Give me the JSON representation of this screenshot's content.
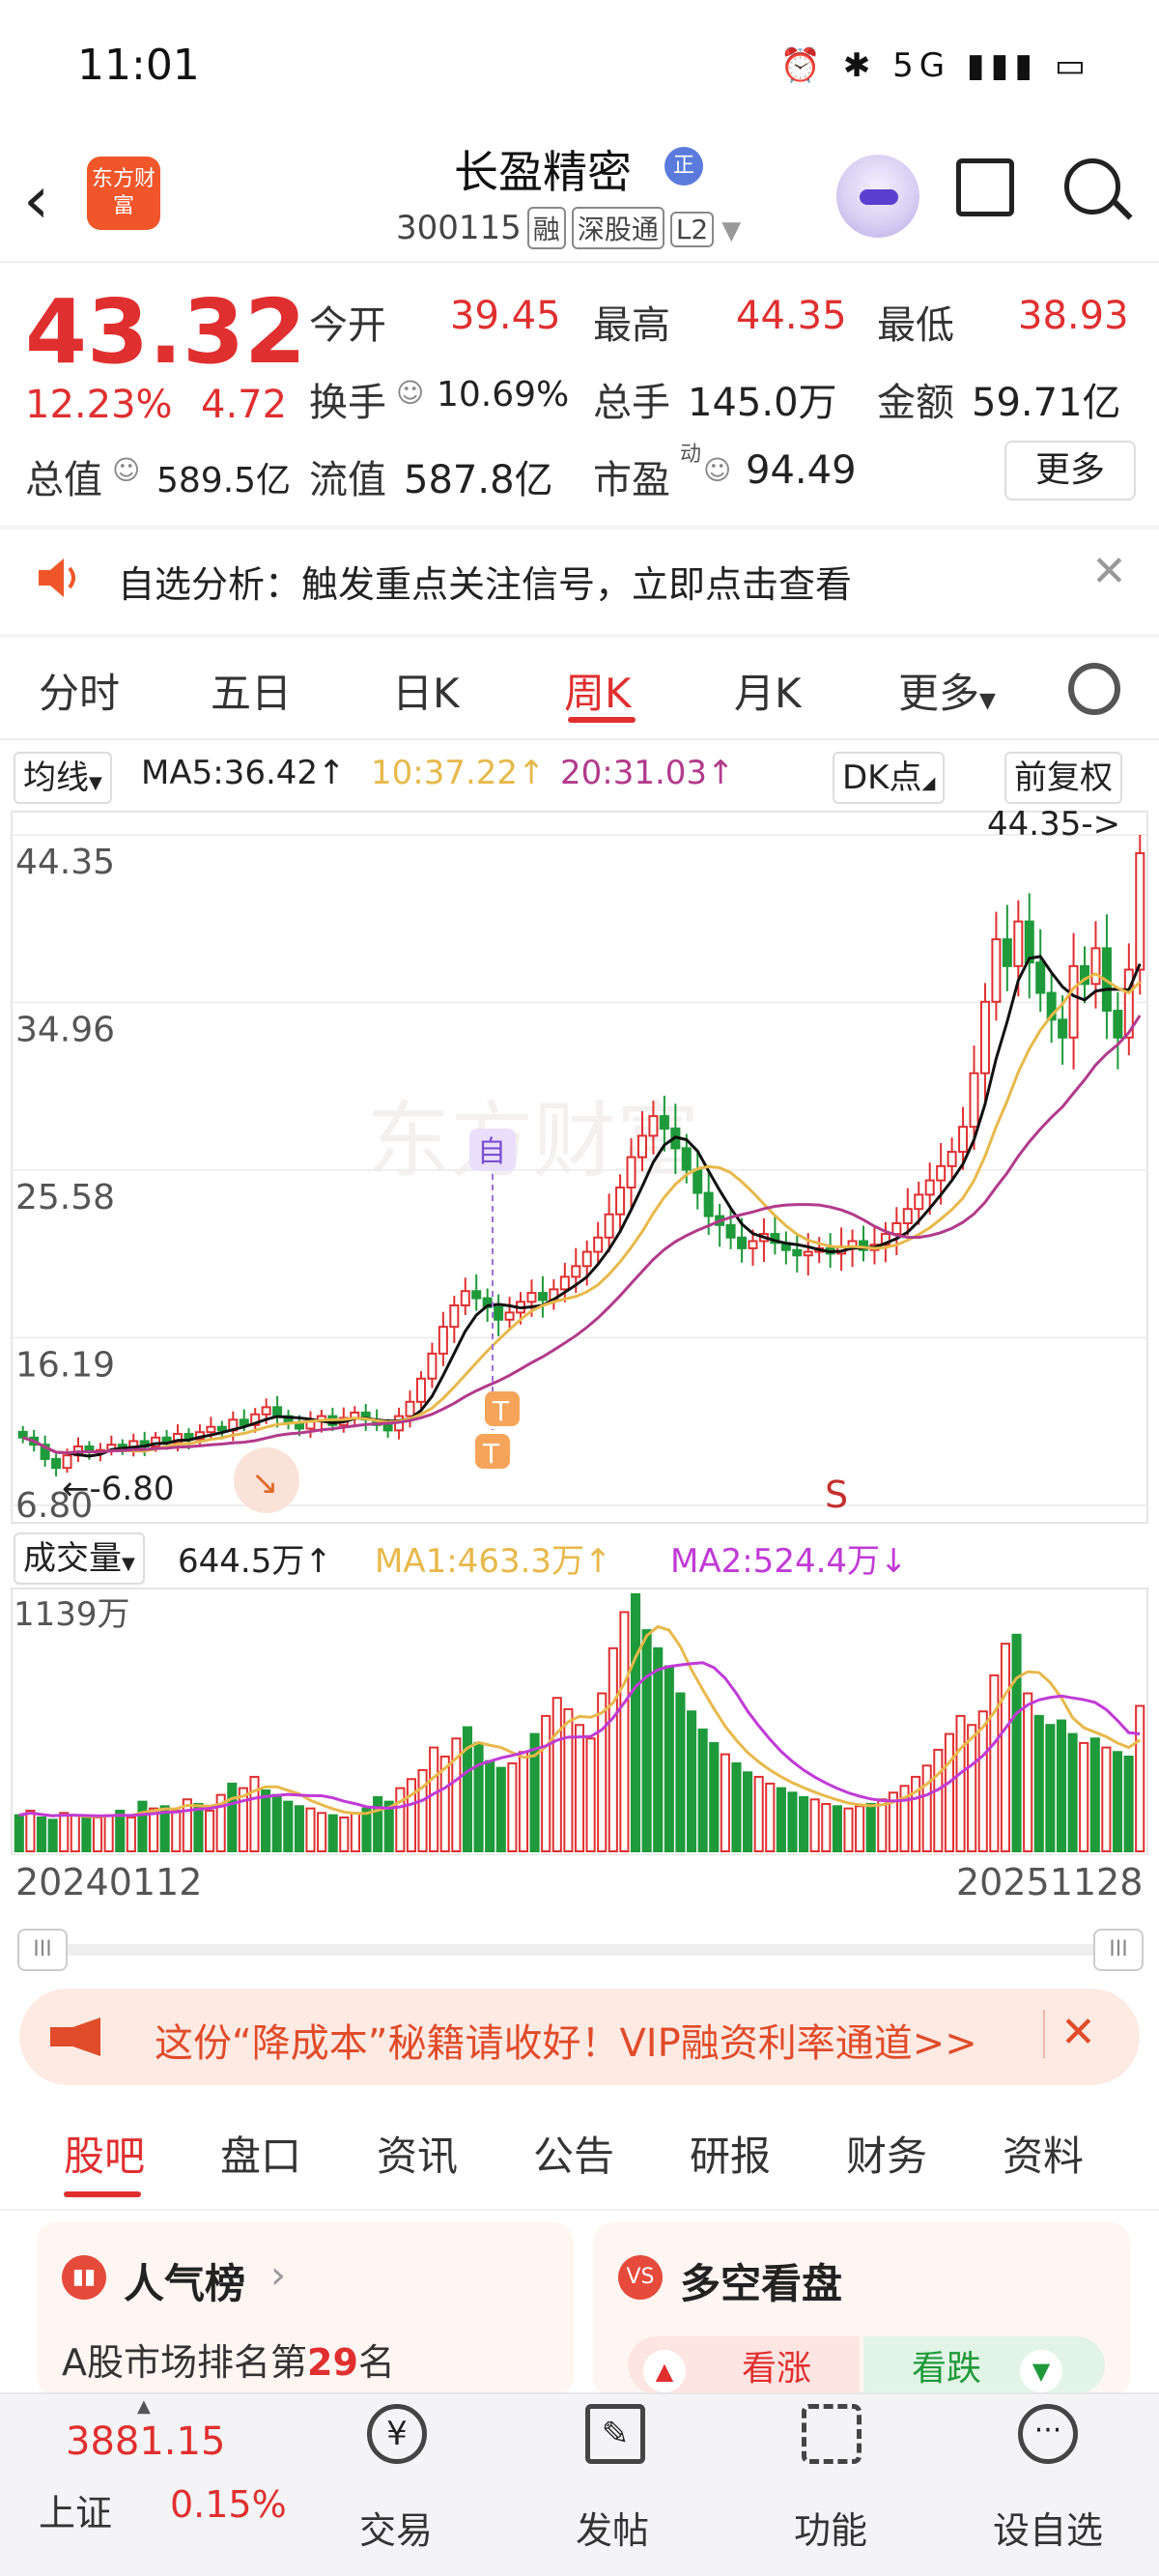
{
  "status_bar": {
    "time": "11:01",
    "icons": "⏰ ✱ 5G ▮▮▮ ▭"
  },
  "header": {
    "logo_text": "东方财富",
    "title": "长盈精密",
    "title_badge": "正",
    "code": "300115",
    "tags": [
      "融",
      "深股通",
      "L2"
    ]
  },
  "quote": {
    "price": "43.32",
    "change_pct": "12.23%",
    "change": "4.72",
    "open_label": "今开",
    "open": "39.45",
    "high_label": "最高",
    "high": "44.35",
    "low_label": "最低",
    "low": "38.93",
    "turnover_label": "换手",
    "turnover": "10.69%",
    "volume_label": "总手",
    "volume": "145.0万",
    "amount_label": "金额",
    "amount": "59.71亿",
    "mktcap_label": "总值",
    "mktcap": "589.5亿",
    "float_label": "流值",
    "float_cap": "587.8亿",
    "pe_label": "市盈",
    "pe_sup": "动",
    "pe": "94.49",
    "more_label": "更多"
  },
  "alert": {
    "text": "自选分析：触发重点关注信号，立即点击查看"
  },
  "chart_tabs": [
    "分时",
    "五日",
    "日K",
    "周K",
    "月K",
    "更多"
  ],
  "chart_controls": {
    "ma_selector": "均线",
    "ma5": "MA5:36.42↑",
    "ma10": "10:37.22↑",
    "ma20": "20:31.03↑",
    "dk_label": "DK点",
    "adjust_label": "前复权"
  },
  "volume_controls": {
    "selector": "成交量",
    "vol": "644.5万↑",
    "ma1": "MA1:463.3万↑",
    "ma2": "MA2:524.4万↓"
  },
  "colors": {
    "up": "#e02f2f",
    "down": "#1f9a3a",
    "ma5": "#111111",
    "ma10": "#e8b84a",
    "ma20": "#b23a8c",
    "vol_ma1": "#e8b84a",
    "vol_ma2": "#c13ad6"
  },
  "chart_data": [
    {
      "type": "candlestick",
      "title": "",
      "y_ticks": [
        "44.35",
        "34.96",
        "25.58",
        "16.19",
        "6.80"
      ],
      "ylim": [
        6.8,
        44.35
      ],
      "max_label": "44.35->",
      "min_label": "←-6.80",
      "marker_self": "自",
      "marker_t": "T",
      "marker_s": "S",
      "watermark": "东方财富",
      "x_range": [
        "20240112",
        "20251128"
      ],
      "closes": [
        10.6,
        10.2,
        9.4,
        8.9,
        9.6,
        10.1,
        9.8,
        9.9,
        10.2,
        10.0,
        10.4,
        10.1,
        10.6,
        10.3,
        10.8,
        10.5,
        10.9,
        11.2,
        11.0,
        11.6,
        11.3,
        11.9,
        12.3,
        11.8,
        11.4,
        11.1,
        11.5,
        11.8,
        11.3,
        11.7,
        12.0,
        11.6,
        11.3,
        11.0,
        11.8,
        12.6,
        13.9,
        15.3,
        16.8,
        18.0,
        18.8,
        18.4,
        17.9,
        17.2,
        17.6,
        18.2,
        18.7,
        18.3,
        18.9,
        19.6,
        20.2,
        21.0,
        21.8,
        23.1,
        24.6,
        26.3,
        27.5,
        28.6,
        27.9,
        26.8,
        25.6,
        24.3,
        23.0,
        22.5,
        21.8,
        21.2,
        21.6,
        22.0,
        21.5,
        21.1,
        20.8,
        21.0,
        21.2,
        20.9,
        21.3,
        21.6,
        21.1,
        21.4,
        22.0,
        22.6,
        23.4,
        24.2,
        25.0,
        25.8,
        26.6,
        28.0,
        31.0,
        35.0,
        38.5,
        37.0,
        39.5,
        37.2,
        35.5,
        34.0,
        33.0,
        37.0,
        36.0,
        38.0,
        34.5,
        33.0,
        36.8,
        43.32
      ],
      "ma5_end": 36.42,
      "ma10_end": 37.22,
      "ma20_end": 31.03
    },
    {
      "type": "bar",
      "title": "",
      "y_top_label": "1139万",
      "ymax": 1139,
      "x_start": "20240112",
      "x_end": "20251128",
      "values": [
        160,
        180,
        150,
        140,
        170,
        160,
        150,
        150,
        160,
        180,
        150,
        220,
        190,
        200,
        180,
        230,
        210,
        180,
        250,
        300,
        280,
        330,
        270,
        250,
        220,
        200,
        190,
        170,
        160,
        150,
        170,
        190,
        240,
        220,
        280,
        320,
        360,
        460,
        420,
        500,
        550,
        480,
        400,
        370,
        390,
        440,
        520,
        600,
        680,
        630,
        560,
        500,
        700,
        900,
        1060,
        1139,
        980,
        900,
        820,
        700,
        620,
        540,
        480,
        430,
        390,
        350,
        330,
        300,
        280,
        260,
        240,
        230,
        210,
        200,
        190,
        200,
        210,
        230,
        260,
        290,
        330,
        380,
        450,
        520,
        600,
        560,
        620,
        780,
        920,
        960,
        700,
        600,
        560,
        580,
        520,
        480,
        500,
        460,
        440,
        420,
        644.5
      ],
      "down_flags": [
        1,
        0,
        1,
        1,
        0,
        0,
        1,
        0,
        0,
        1,
        0,
        1,
        0,
        1,
        0,
        0,
        1,
        0,
        0,
        1,
        0,
        0,
        1,
        1,
        1,
        1,
        0,
        0,
        1,
        0,
        0,
        1,
        1,
        1,
        0,
        0,
        0,
        0,
        0,
        0,
        1,
        1,
        1,
        1,
        0,
        0,
        1,
        0,
        0,
        0,
        0,
        0,
        0,
        0,
        0,
        1,
        1,
        1,
        1,
        1,
        1,
        1,
        1,
        0,
        1,
        1,
        0,
        0,
        1,
        1,
        1,
        0,
        0,
        1,
        0,
        0,
        1,
        0,
        0,
        0,
        0,
        0,
        0,
        0,
        0,
        0,
        0,
        0,
        0,
        1,
        0,
        1,
        1,
        1,
        1,
        0,
        1,
        0,
        1,
        1,
        0,
        0
      ]
    }
  ],
  "bottom_tabs": [
    "股吧",
    "盘口",
    "资讯",
    "公告",
    "研报",
    "财务",
    "资料"
  ],
  "promo": {
    "text": "这份“降成本”秘籍请收好！VIP融资利率通道>>"
  },
  "cards": {
    "popularity": {
      "title": "人气榜",
      "icon": "▮▮",
      "rank_prefix": "A股市场排名第",
      "rank": "29",
      "rank_suffix": "名"
    },
    "sentiment": {
      "title": "多空看盘",
      "icon": "VS",
      "bull": "看涨",
      "bear": "看跌"
    }
  },
  "bottom_nav": {
    "index_value": "3881.15",
    "index_name": "上证",
    "index_change": "0.15%",
    "items": [
      "交易",
      "发帖",
      "功能",
      "设自选"
    ]
  }
}
